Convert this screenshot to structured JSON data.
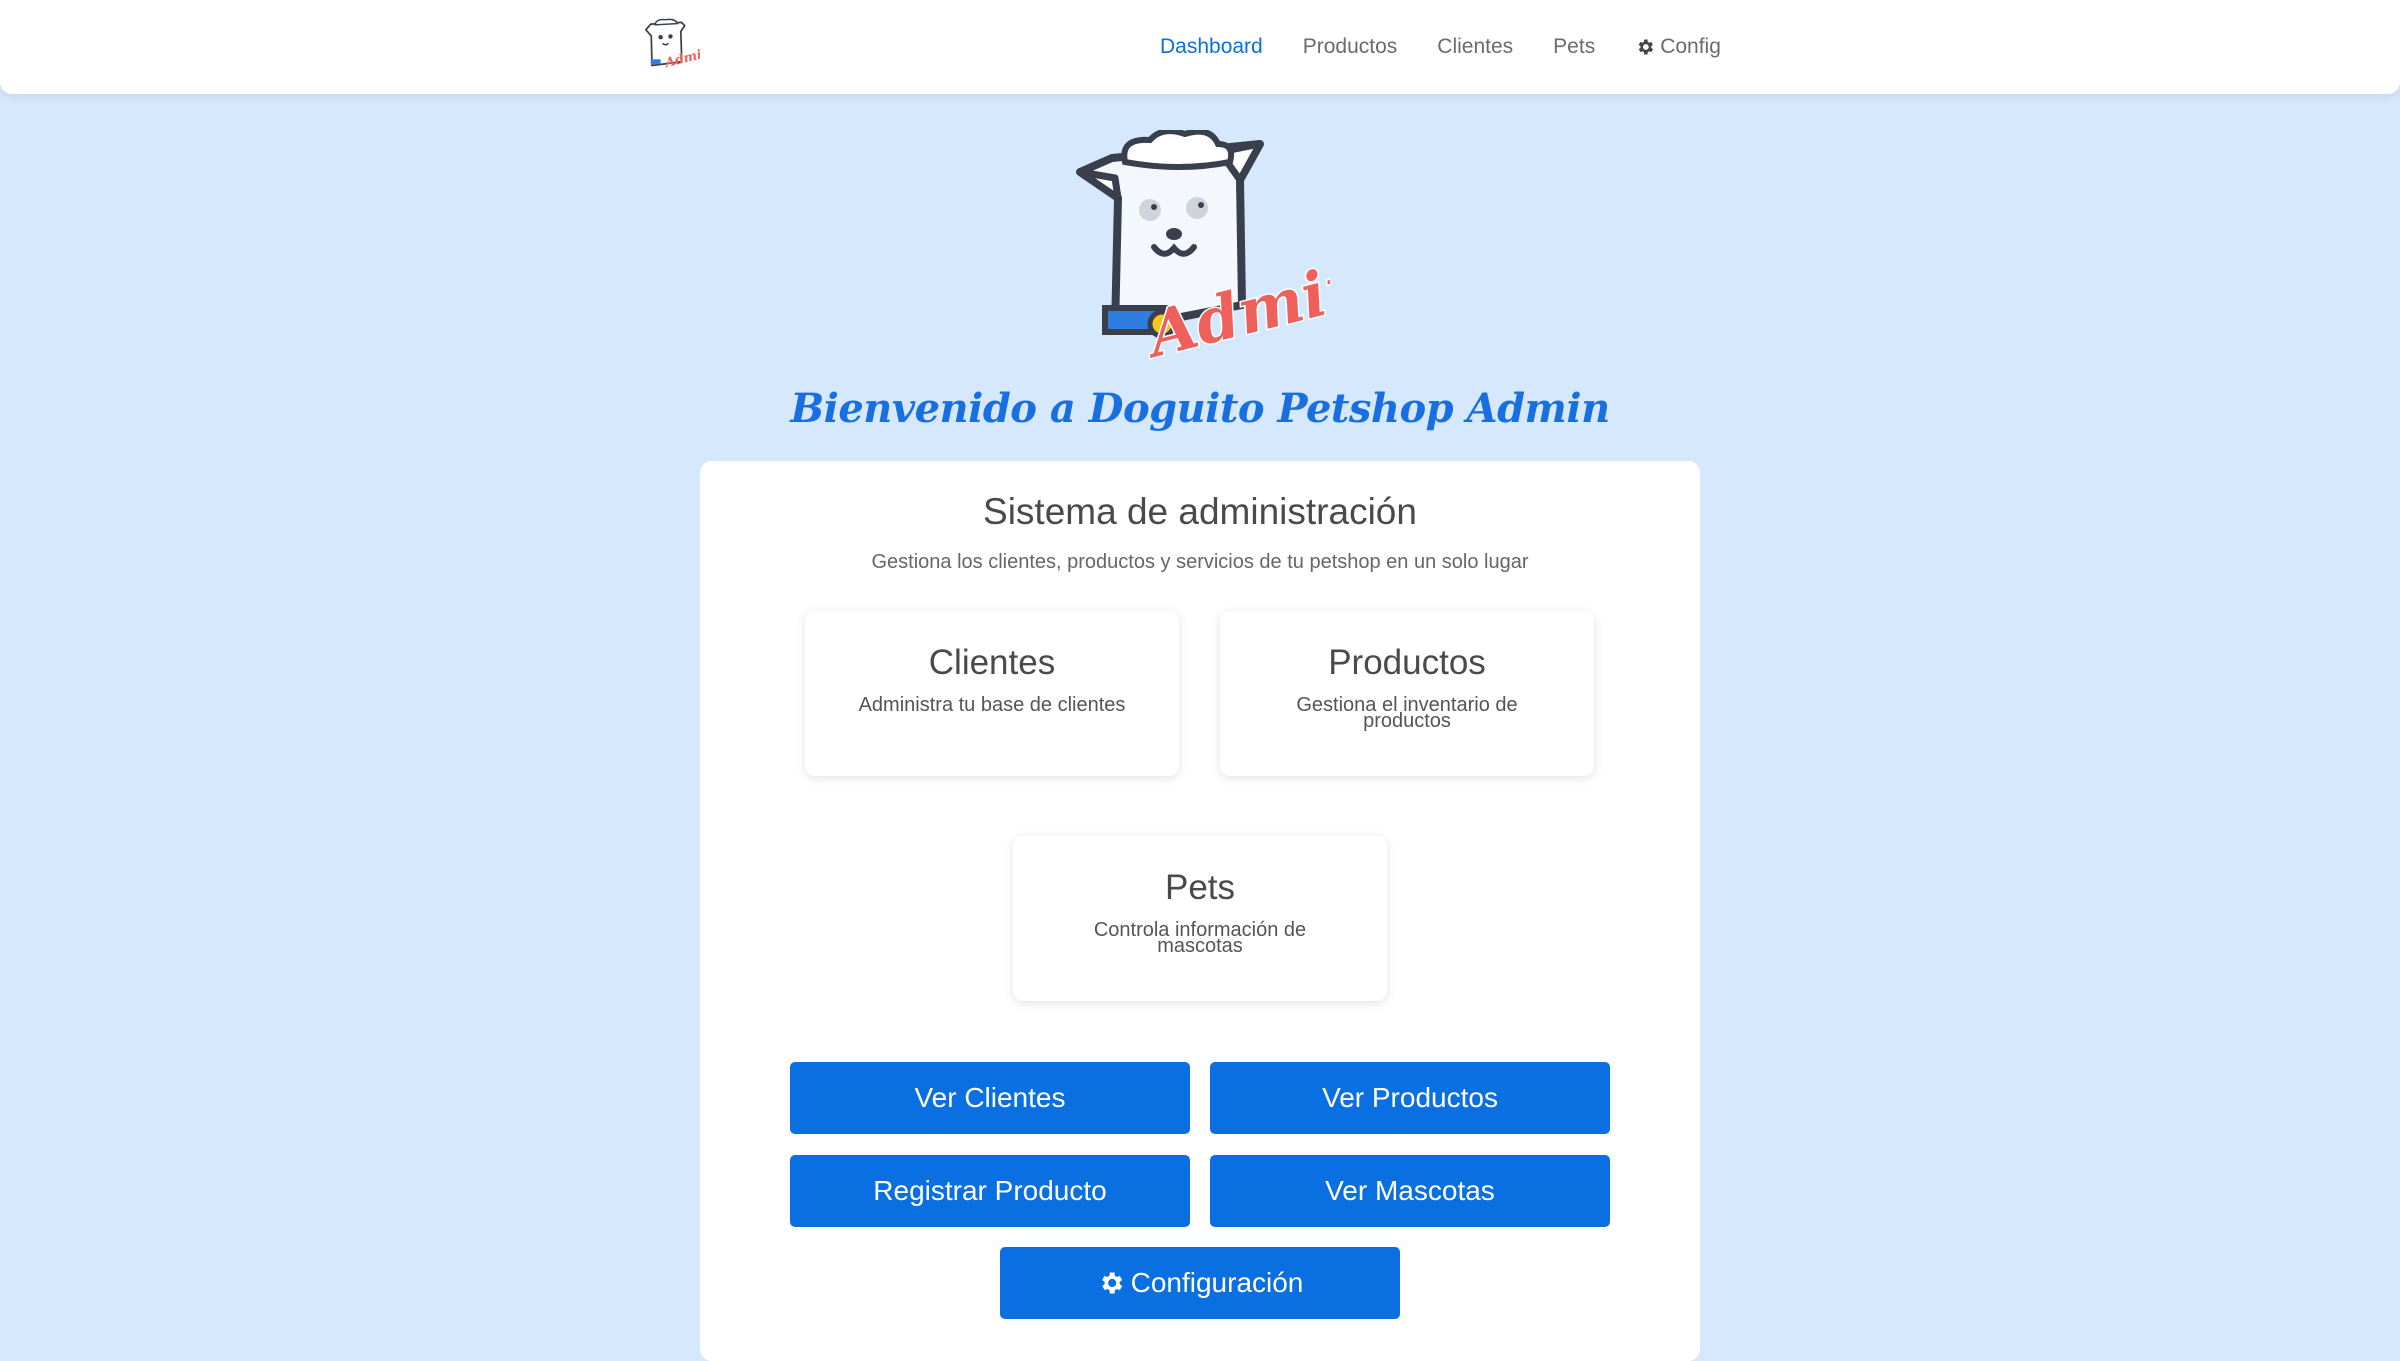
{
  "nav": {
    "logo_text": "Admin",
    "links": [
      {
        "label": "Dashboard",
        "active": true
      },
      {
        "label": "Productos"
      },
      {
        "label": "Clientes"
      },
      {
        "label": "Pets"
      },
      {
        "label": "Config",
        "icon": "gear-icon"
      }
    ]
  },
  "hero": {
    "logo_text": "Admin",
    "welcome": "Bienvenido a Doguito Petshop Admin"
  },
  "panel": {
    "title": "Sistema de administración",
    "subtitle": "Gestiona los clientes, productos y servicios de tu petshop en un solo lugar",
    "cards": [
      {
        "title": "Clientes",
        "desc": "Administra tu base de clientes"
      },
      {
        "title": "Productos",
        "desc": "Gestiona el inventario de productos"
      },
      {
        "title": "Pets",
        "desc": "Controla información de mascotas"
      }
    ],
    "buttons": [
      {
        "label": "Ver Clientes"
      },
      {
        "label": "Ver Productos"
      },
      {
        "label": "Registrar Producto"
      },
      {
        "label": "Ver Mascotas"
      },
      {
        "label": "Configuración",
        "icon": "gear-icon"
      }
    ]
  },
  "colors": {
    "accent": "#0a6fe0",
    "background": "#d6e8fd",
    "logo_script": "#f0605a"
  }
}
